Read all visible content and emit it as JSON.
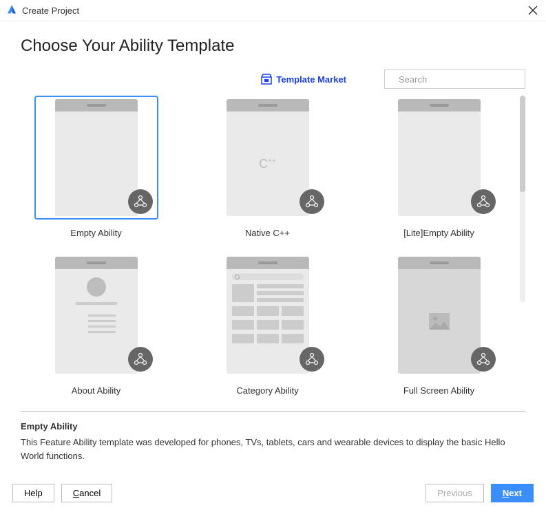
{
  "window": {
    "title": "Create Project"
  },
  "heading": "Choose Your Ability Template",
  "market_link": "Template Market",
  "search": {
    "placeholder": "Search"
  },
  "templates": [
    {
      "label": "Empty Ability",
      "selected": true
    },
    {
      "label": "Native C++",
      "selected": false
    },
    {
      "label": "[Lite]Empty Ability",
      "selected": false
    },
    {
      "label": "About Ability",
      "selected": false
    },
    {
      "label": "Category Ability",
      "selected": false
    },
    {
      "label": "Full Screen Ability",
      "selected": false
    }
  ],
  "description": {
    "title": "Empty Ability",
    "text": "This Feature Ability template was developed for phones, TVs, tablets, cars and wearable devices to display the basic Hello World functions."
  },
  "buttons": {
    "help": "Help",
    "cancel": "Cancel",
    "previous": "Previous",
    "next": "Next"
  }
}
